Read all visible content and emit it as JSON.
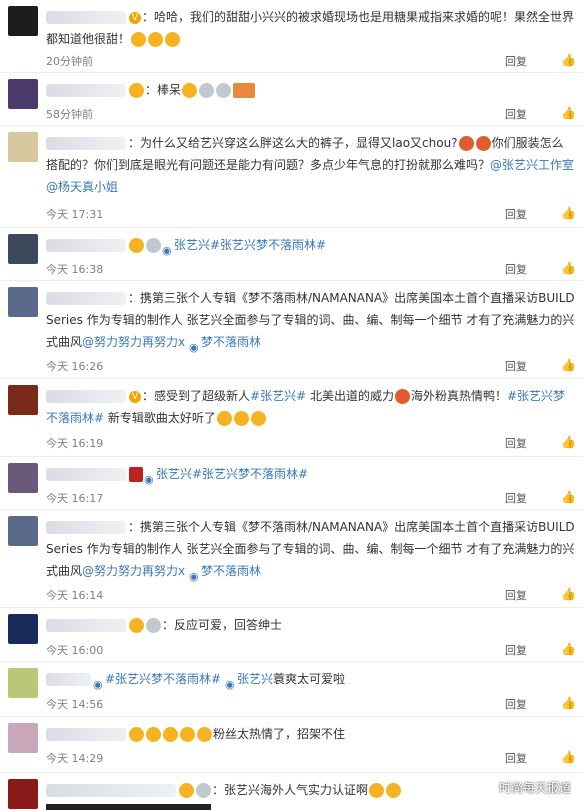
{
  "comments": [
    {
      "text_main": "：哈哈，我们的甜甜小兴兴的被求婚现场也是用糖果戒指来求婚的呢！果然全世界都知道他很甜！",
      "time": "20分钟前",
      "reply": "回复"
    },
    {
      "text_main": "：棒呆",
      "time": "58分钟前",
      "reply": "回复"
    },
    {
      "text_main": "：为什么又给艺兴穿这么胖这么大的裤子，显得又lao又chou?",
      "text_after": "你们服装怎么搭配的？你们到底是眼光有问题还是能力有问题？多点少年气息的打扮就那么难吗？",
      "mention1": "@张艺兴工作室",
      "mention2": "@杨天真小姐",
      "time": "今天 17:31",
      "reply": "回复"
    },
    {
      "tag": "张艺兴#张艺兴梦不落雨林#",
      "time": "今天 16:38",
      "reply": "回复"
    },
    {
      "text_main": "：携第三张个人专辑《梦不落雨林/NAMANANA》出席美国本土首个直播采访BUILD Series 作为专辑的制作人 张艺兴全面参与了专辑的词、曲、编、制每一个细节 才有了充满魅力的兴式曲风",
      "mention1": "@努力努力再努力x",
      "tag": "梦不落雨林",
      "time": "今天 16:26",
      "reply": "回复"
    },
    {
      "text_main": "：感受到了超级新人",
      "tag1": "#张艺兴#",
      "text_mid": " 北美出道的威力",
      "text_mid2": "海外粉真热情鸭！",
      "tag2": "#张艺兴梦不落雨林#",
      "text_end": " 新专辑歌曲太好听了",
      "time": "今天 16:19",
      "reply": "回复"
    },
    {
      "tag": "张艺兴#张艺兴梦不落雨林#",
      "time": "今天 16:17",
      "reply": "回复"
    },
    {
      "text_main": "：携第三张个人专辑《梦不落雨林/NAMANANA》出席美国本土首个直播采访BUILD Series 作为专辑的制作人 张艺兴全面参与了专辑的词、曲、编、制每一个细节 才有了充满魅力的兴式曲风",
      "mention1": "@努力努力再努力x",
      "tag": "梦不落雨林",
      "time": "今天 16:14",
      "reply": "回复"
    },
    {
      "text_main": "：反应可爱，回答绅士",
      "time": "今天 16:00",
      "reply": "回复"
    },
    {
      "tag1": "#张艺兴梦不落雨林#",
      "tag2": "张艺兴",
      "text_end": "蓑爽太可爱啦",
      "time": "今天 14:56",
      "reply": "回复"
    },
    {
      "text_main": "粉丝太热情了，招架不住",
      "time": "今天 14:29",
      "reply": "回复"
    },
    {
      "text_main": "：张艺兴海外人气实力认证啊",
      "time": "",
      "reply": ""
    }
  ],
  "watermark": "时尚每天报道",
  "icons": {
    "like": "thumbs-up-icon",
    "pin": "location-pin-icon"
  }
}
